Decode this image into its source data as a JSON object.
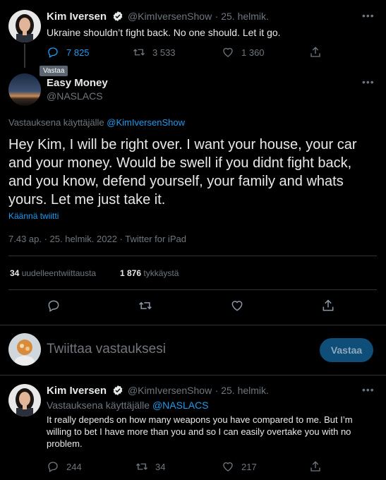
{
  "tweet1": {
    "name": "Kim Iversen",
    "handle": "@KimIversenShow",
    "date": "· 25. helmik.",
    "text": "Ukraine shouldn’t fight back. No one should. Let it go.",
    "replies": "7 825",
    "retweets": "3 533",
    "likes": "1 360",
    "tooltip": "Vastaa"
  },
  "main": {
    "name": "Easy Money",
    "handle": "@NASLACS",
    "reply_to_prefix": "Vastauksena käyttäjälle",
    "reply_to_handle": "@KimIversenShow",
    "text": "Hey Kim, I will be right over. I want your house, your car and your money. Would be swell if you didnt fight back, and you know, defend yourself, your family and whats yours. Let me just take it.",
    "translate": "Käännä twiitti",
    "timestamp": "7.43 ap. · 25. helmik. 2022 · Twitter for iPad",
    "retweet_count": "34",
    "retweet_label": "uudelleentwiittausta",
    "like_count": "1 876",
    "like_label": "tykkäystä"
  },
  "composer": {
    "placeholder": "Twiittaa vastauksesi",
    "button": "Vastaa"
  },
  "tweet3": {
    "name": "Kim Iversen",
    "handle": "@KimIversenShow",
    "date": "· 25. helmik.",
    "reply_to_prefix": "Vastauksena käyttäjälle",
    "reply_to_handle": "@NASLACS",
    "text": "It really depends on how many weapons you have compared to me. But I’m willing to bet I have more than you and so I can easily overtake you with no problem.",
    "replies": "244",
    "retweets": "34",
    "likes": "217"
  },
  "colors": {
    "background": "#000000",
    "accent": "#1d9bf0",
    "muted": "#6e767d",
    "button_bg": "#0f4e78",
    "text": "#e7e9ea"
  }
}
